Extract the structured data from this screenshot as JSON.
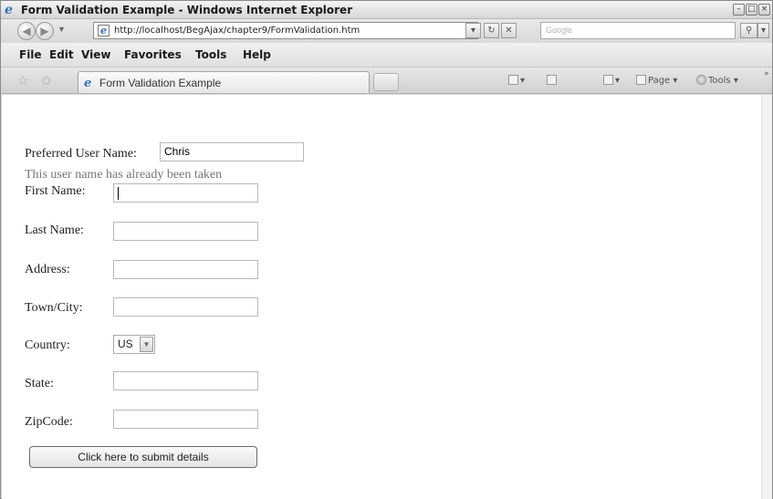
{
  "window": {
    "title": "Form Validation Example - Windows Internet Explorer",
    "controls": [
      "–",
      "□",
      "×"
    ]
  },
  "address_bar": {
    "url": "http://localhost/BegAjax/chapter9/FormValidation.htm",
    "search_placeholder": "Google"
  },
  "menu": {
    "items": [
      "File",
      "Edit",
      "View",
      "Favorites",
      "Tools",
      "Help"
    ]
  },
  "tabs": [
    {
      "label": "Form Validation Example",
      "active": true
    }
  ],
  "command_bar": {
    "page_label": "Page",
    "tools_label": "Tools"
  },
  "form": {
    "preferred_label": "Preferred User Name:",
    "preferred_value": "Chris",
    "error_message": "This user name has already been taken",
    "fields": [
      {
        "label": "First Name:",
        "value": ""
      },
      {
        "label": "Last Name:",
        "value": ""
      },
      {
        "label": "Address:",
        "value": ""
      },
      {
        "label": "Town/City:",
        "value": ""
      },
      {
        "label": "Country:",
        "value": "US"
      },
      {
        "label": "State:",
        "value": ""
      },
      {
        "label": "ZipCode:",
        "value": ""
      }
    ],
    "submit_label": "Click here to submit details"
  },
  "icons": {
    "browser": "ie-logo-icon",
    "back": "back-arrow-icon",
    "forward": "forward-arrow-icon",
    "refresh": "refresh-icon",
    "stop": "stop-icon",
    "search": "search-icon",
    "favorites": "favorites-star-icon",
    "add_favorites": "add-favorites-icon",
    "home": "home-icon",
    "feeds": "feeds-icon",
    "print": "print-icon"
  },
  "colors": {
    "ie_blue": "#3a6fb6",
    "chrome_gray": "#dcdcdc",
    "error_text": "#777777"
  }
}
